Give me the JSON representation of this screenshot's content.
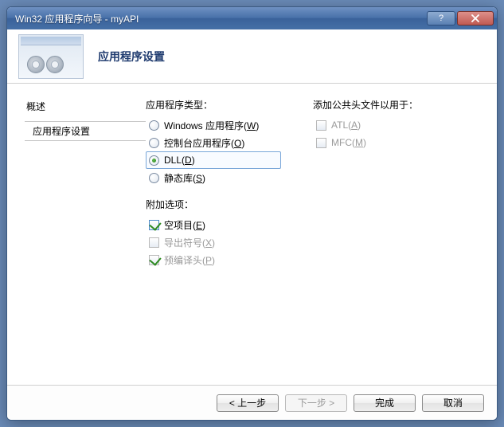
{
  "window": {
    "title": "Win32 应用程序向导 - myAPI"
  },
  "header": {
    "title": "应用程序设置"
  },
  "sidebar": {
    "items": [
      {
        "label": "概述"
      },
      {
        "label": "应用程序设置"
      }
    ],
    "active_index": 1
  },
  "content": {
    "app_type": {
      "label": "应用程序类型：",
      "options": [
        {
          "label": "Windows 应用程序",
          "mnemonic": "W",
          "selected": false
        },
        {
          "label": "控制台应用程序",
          "mnemonic": "O",
          "selected": false
        },
        {
          "label": "DLL",
          "mnemonic": "D",
          "selected": true
        },
        {
          "label": "静态库",
          "mnemonic": "S",
          "selected": false
        }
      ]
    },
    "add_options": {
      "label": "附加选项：",
      "options": [
        {
          "label": "空项目",
          "mnemonic": "E",
          "checked": true,
          "disabled": false
        },
        {
          "label": "导出符号",
          "mnemonic": "X",
          "checked": false,
          "disabled": true
        },
        {
          "label": "预编译头",
          "mnemonic": "P",
          "checked": true,
          "disabled": true
        }
      ]
    },
    "common_headers": {
      "label": "添加公共头文件以用于：",
      "options": [
        {
          "label": "ATL",
          "mnemonic": "A",
          "checked": false,
          "disabled": true
        },
        {
          "label": "MFC",
          "mnemonic": "M",
          "checked": false,
          "disabled": true
        }
      ]
    }
  },
  "footer": {
    "prev": "< 上一步",
    "next": "下一步 >",
    "finish": "完成",
    "cancel": "取消",
    "next_disabled": true
  }
}
